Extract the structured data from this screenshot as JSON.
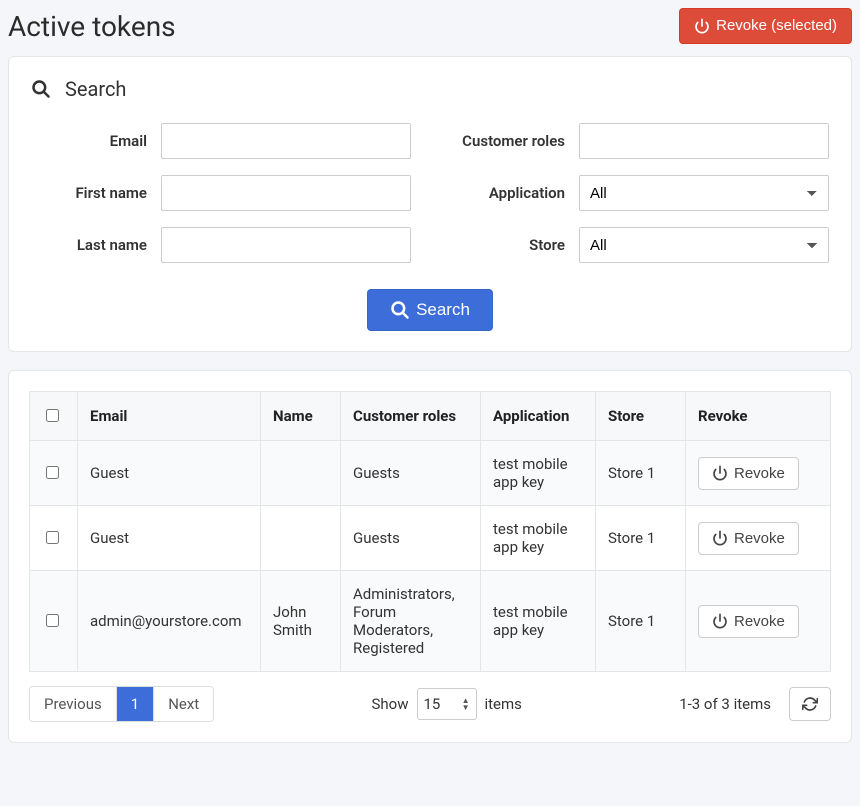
{
  "header": {
    "title": "Active tokens",
    "revoke_selected_label": "Revoke (selected)"
  },
  "search": {
    "heading": "Search",
    "email_label": "Email",
    "firstname_label": "First name",
    "lastname_label": "Last name",
    "roles_label": "Customer roles",
    "application_label": "Application",
    "store_label": "Store",
    "app_options": [
      "All"
    ],
    "app_selected": "All",
    "store_options": [
      "All"
    ],
    "store_selected": "All",
    "search_button": "Search"
  },
  "table": {
    "columns": {
      "email": "Email",
      "name": "Name",
      "roles": "Customer roles",
      "application": "Application",
      "store": "Store",
      "revoke": "Revoke"
    },
    "revoke_button": "Revoke",
    "rows": [
      {
        "email": "Guest",
        "name": "",
        "roles": "Guests",
        "application": "test mobile app key",
        "store": "Store 1"
      },
      {
        "email": "Guest",
        "name": "",
        "roles": "Guests",
        "application": "test mobile app key",
        "store": "Store 1"
      },
      {
        "email": "admin@yourstore.com",
        "name": "John Smith",
        "roles": "Administrators, Forum Moderators, Registered",
        "application": "test mobile app key",
        "store": "Store 1"
      }
    ]
  },
  "footer": {
    "previous": "Previous",
    "next": "Next",
    "page": "1",
    "show_label": "Show",
    "show_value": "15",
    "items_label": "items",
    "summary": "1-3 of 3 items"
  }
}
